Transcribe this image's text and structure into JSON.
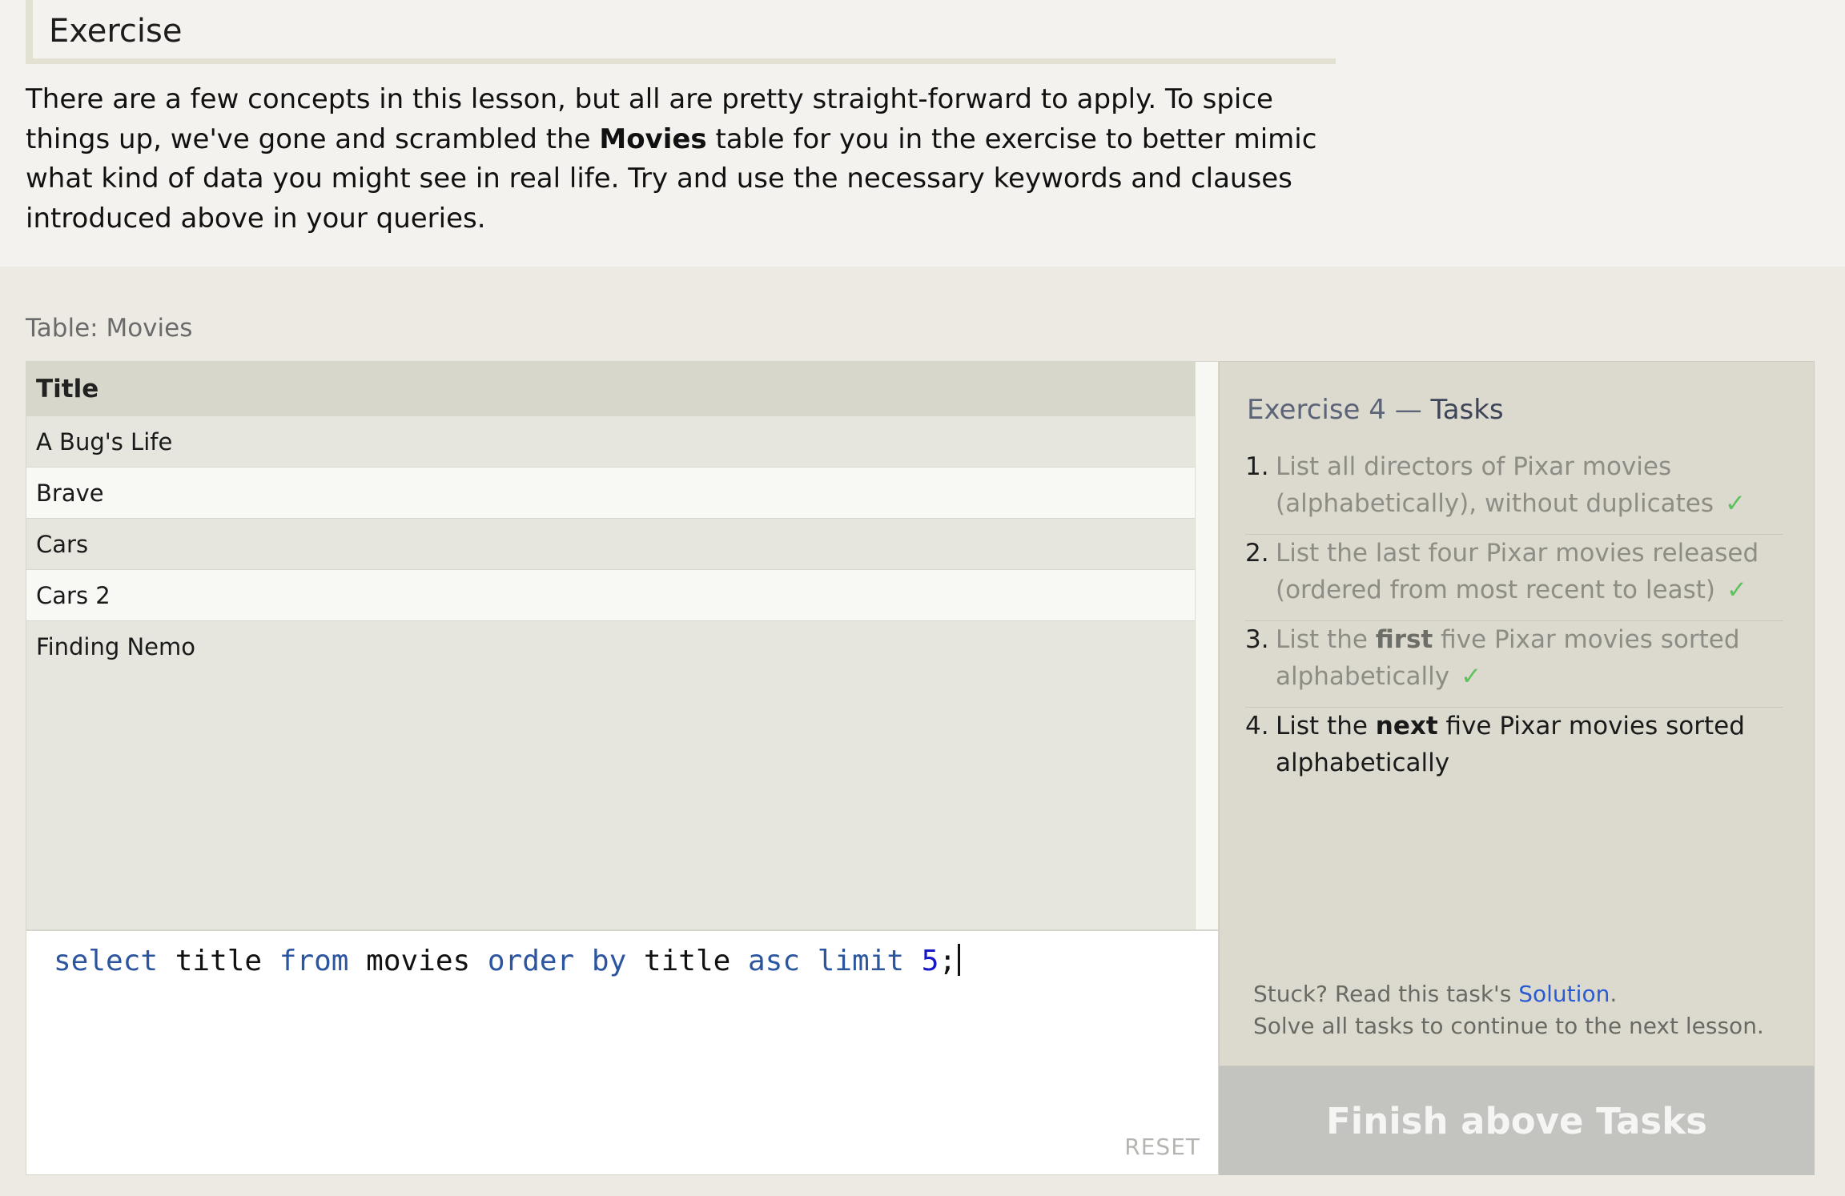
{
  "lesson": {
    "heading": "Exercise",
    "paragraph_part1": "There are a few concepts in this lesson, but all are pretty straight-forward to apply. To spice things up, we've gone and scrambled the ",
    "paragraph_bold": "Movies",
    "paragraph_part2": " table for you in the exercise to better mimic what kind of data you might see in real life. Try and use the necessary keywords and clauses introduced above in your queries."
  },
  "table": {
    "label": "Table: Movies",
    "column_header": "Title",
    "rows": [
      "A Bug's Life",
      "Brave",
      "Cars",
      "Cars 2",
      "Finding Nemo"
    ]
  },
  "editor": {
    "tokens": {
      "t1": "select",
      "t2": " title ",
      "t3": "from",
      "t4": " movies ",
      "t5": "order by",
      "t6": " title ",
      "t7": "asc",
      "t8": " ",
      "t9": "limit",
      "t10": " ",
      "t11": "5",
      "t12": ";"
    },
    "reset_label": "RESET"
  },
  "tasks": {
    "title_prefix": "Exercise 4 — ",
    "title_strong": "Tasks",
    "check_mark": "✓",
    "items": [
      {
        "number": "1.",
        "text": "List all directors of Pixar movies (alphabetically), without duplicates",
        "done": true
      },
      {
        "number": "2.",
        "text": "List the last four Pixar movies released (ordered from most recent to least)",
        "done": true
      },
      {
        "number": "3.",
        "pre": "List the ",
        "bold": "first",
        "post": " five Pixar movies sorted alphabetically",
        "done": true
      },
      {
        "number": "4.",
        "pre": "List the ",
        "bold": "next",
        "post": " five Pixar movies sorted alphabetically",
        "done": false
      }
    ],
    "stuck_prefix": "Stuck? Read this task's ",
    "solution_link": "Solution",
    "stuck_suffix": ".",
    "solve_all": "Solve all tasks to continue to the next lesson.",
    "finish_button": "Finish above Tasks"
  }
}
